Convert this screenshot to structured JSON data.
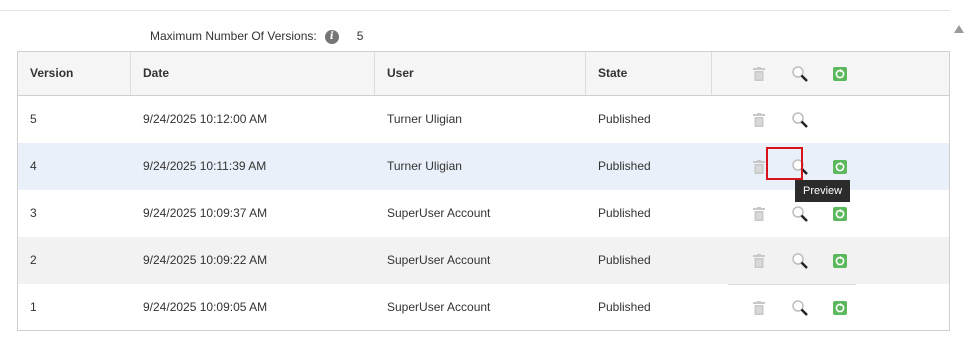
{
  "settings": {
    "max_versions_label": "Maximum Number Of Versions:",
    "max_versions_value": "5"
  },
  "table": {
    "columns": [
      "Version",
      "Date",
      "User",
      "State"
    ],
    "rows": [
      {
        "version": "5",
        "date": "9/24/2025 10:12:00 AM",
        "user": "Turner Uligian",
        "state": "Published"
      },
      {
        "version": "4",
        "date": "9/24/2025 10:11:39 AM",
        "user": "Turner Uligian",
        "state": "Published"
      },
      {
        "version": "3",
        "date": "9/24/2025 10:09:37 AM",
        "user": "SuperUser Account",
        "state": "Published"
      },
      {
        "version": "2",
        "date": "9/24/2025 10:09:22 AM",
        "user": "SuperUser Account",
        "state": "Published"
      },
      {
        "version": "1",
        "date": "9/24/2025 10:09:05 AM",
        "user": "SuperUser Account",
        "state": "Published"
      }
    ],
    "row_actions": {
      "rollback_hidden_rows": [
        0
      ]
    }
  },
  "tooltip": {
    "text": "Preview"
  },
  "icons": {
    "delete": "trash-icon",
    "preview": "magnifier-icon",
    "rollback": "rollback-icon",
    "info": "info-icon"
  },
  "colors": {
    "rollback_green": "#5cb85c",
    "highlight_red": "#d6121b",
    "hover_row": "#e9f0f9",
    "alt_row": "#f2f2f2"
  }
}
